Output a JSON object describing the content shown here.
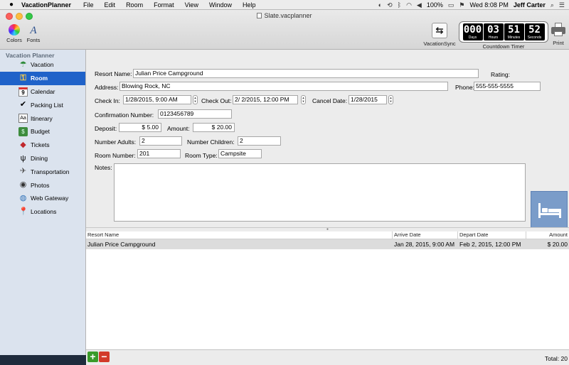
{
  "menubar": {
    "app_name": "VacationPlanner",
    "items": [
      "File",
      "Edit",
      "Room",
      "Format",
      "View",
      "Window",
      "Help"
    ],
    "battery": "100%",
    "clock": "Wed 8:08 PM",
    "user": "Jeff Carter"
  },
  "window": {
    "title": "Slate.vacplanner"
  },
  "toolbar": {
    "colors_label": "Colors",
    "fonts_label": "Fonts",
    "fonts_glyph": "A",
    "sync_label": "VacationSync",
    "timer_label": "Countdown Timer",
    "print_label": "Print",
    "timer": {
      "days": "000",
      "days_label": "Days",
      "hours": "03",
      "hours_label": "Hours",
      "minutes": "51",
      "minutes_label": "Minutes",
      "seconds": "52",
      "seconds_label": "Seconds"
    }
  },
  "sidebar": {
    "header": "Vacation Planner",
    "items": [
      {
        "label": "Vacation",
        "icon": "umbrella-icon"
      },
      {
        "label": "Room",
        "icon": "key-icon"
      },
      {
        "label": "Calendar",
        "icon": "calendar-icon",
        "glyph": "9"
      },
      {
        "label": "Packing List",
        "icon": "checkmark-icon"
      },
      {
        "label": "Itinerary",
        "icon": "dictionary-icon",
        "glyph": "Aa"
      },
      {
        "label": "Budget",
        "icon": "money-icon"
      },
      {
        "label": "Tickets",
        "icon": "ticket-icon"
      },
      {
        "label": "Dining",
        "icon": "fork-knife-icon"
      },
      {
        "label": "Transportation",
        "icon": "airplane-icon"
      },
      {
        "label": "Photos",
        "icon": "camera-icon"
      },
      {
        "label": "Web Gateway",
        "icon": "globe-icon"
      },
      {
        "label": "Locations",
        "icon": "pushpin-icon"
      }
    ],
    "selected": "Room"
  },
  "form": {
    "resort_name_label": "Resort Name:",
    "resort_name": "Julian Price Campground",
    "rating_label": "Rating:",
    "address_label": "Address:",
    "address": "Blowing Rock, NC",
    "phone_label": "Phone:",
    "phone": "555-555-5555",
    "checkin_label": "Check In:",
    "checkin": "1/28/2015,  9:00 AM",
    "checkout_label": "Check Out:",
    "checkout": "2/  2/2015, 12:00 PM",
    "cancel_label": "Cancel Date:",
    "cancel_date": "1/28/2015",
    "confirmation_label": "Confirmation Number:",
    "confirmation": "0123456789",
    "deposit_label": "Deposit:",
    "deposit": "$ 5.00",
    "amount_label": "Amount:",
    "amount": "$ 20.00",
    "adults_label": "Number Adults:",
    "adults": "2",
    "children_label": "Number Children:",
    "children": "2",
    "room_number_label": "Room Number:",
    "room_number": "201",
    "room_type_label": "Room Type:",
    "room_type": "Campsite",
    "notes_label": "Notes:",
    "notes": ""
  },
  "table": {
    "columns": [
      "Resort Name",
      "Arrive Date",
      "Depart Date",
      "Amount"
    ],
    "rows": [
      [
        "Julian Price Campground",
        "Jan 28, 2015, 9:00 AM",
        "Feb 2, 2015, 12:00 PM",
        "$ 20.00"
      ]
    ]
  },
  "footer": {
    "total": "Total: 20",
    "add_glyph": "+",
    "remove_glyph": "−"
  },
  "colors": {
    "selection": "#1f62c9",
    "sidebar": "#dbe3ee",
    "room_image": "#7a9cc9"
  }
}
